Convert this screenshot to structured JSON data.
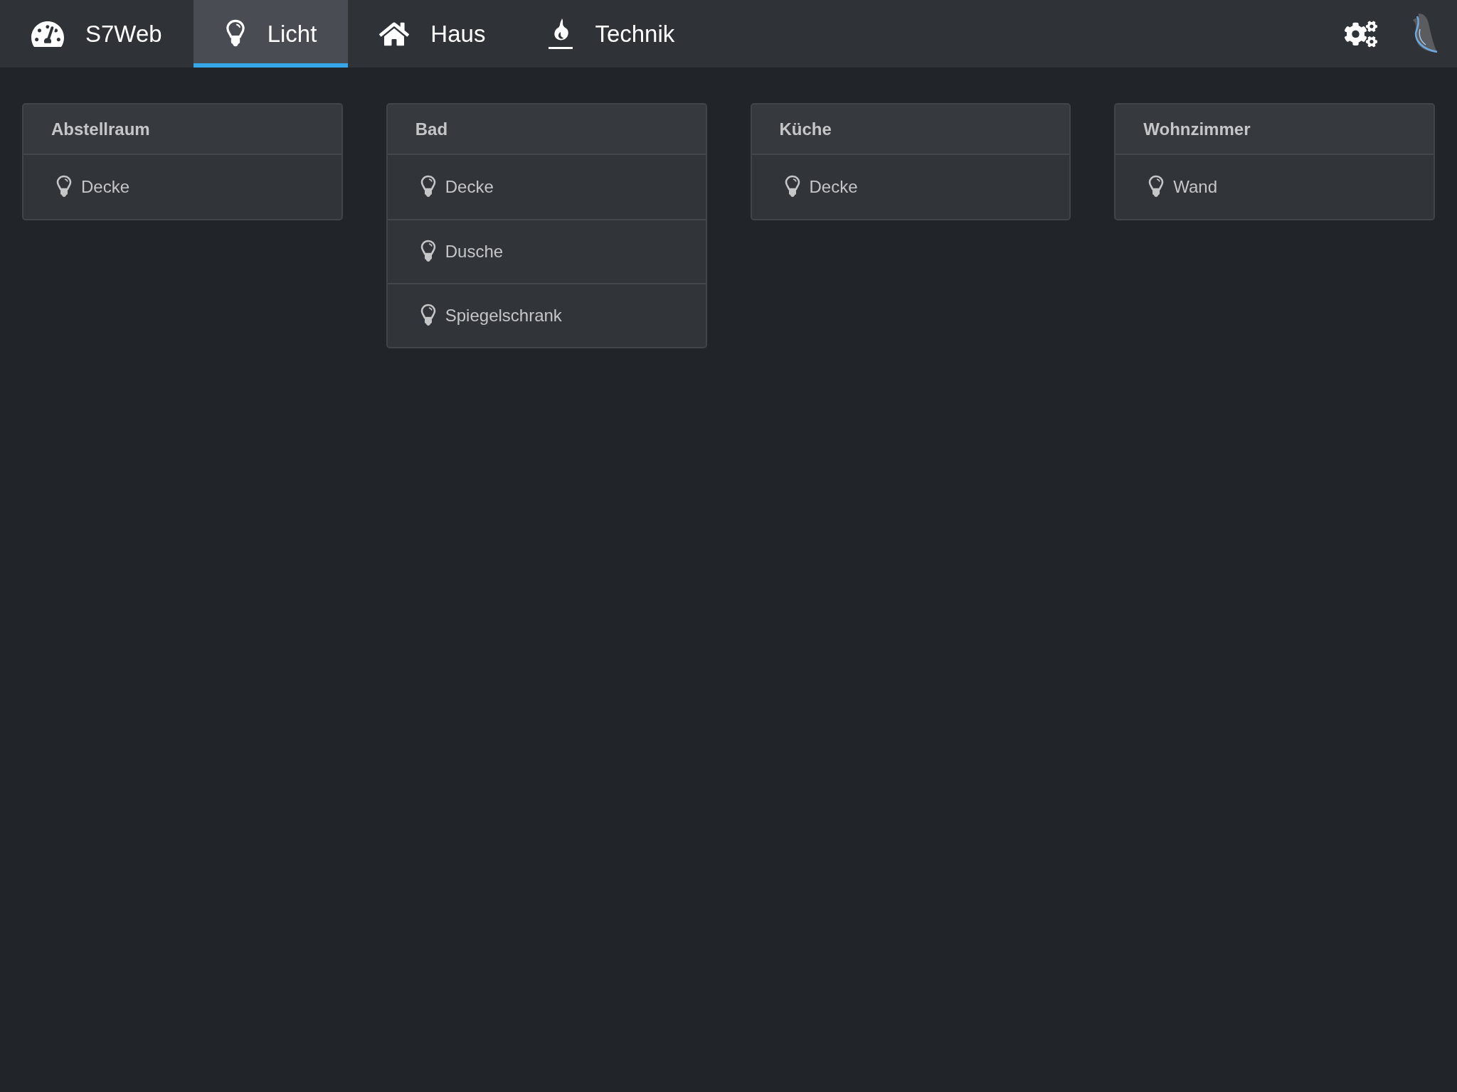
{
  "nav": {
    "tabs": [
      {
        "label": "S7Web",
        "selected": false
      },
      {
        "label": "Licht",
        "selected": true
      },
      {
        "label": "Haus",
        "selected": false
      },
      {
        "label": "Technik",
        "selected": false
      }
    ]
  },
  "rooms": [
    {
      "title": "Abstellraum",
      "lights": [
        {
          "label": "Decke"
        }
      ]
    },
    {
      "title": "Bad",
      "lights": [
        {
          "label": "Decke"
        },
        {
          "label": "Dusche"
        },
        {
          "label": "Spiegelschrank"
        }
      ]
    },
    {
      "title": "Küche",
      "lights": [
        {
          "label": "Decke"
        }
      ]
    },
    {
      "title": "Wohnzimmer",
      "lights": [
        {
          "label": "Wand"
        }
      ]
    }
  ]
}
